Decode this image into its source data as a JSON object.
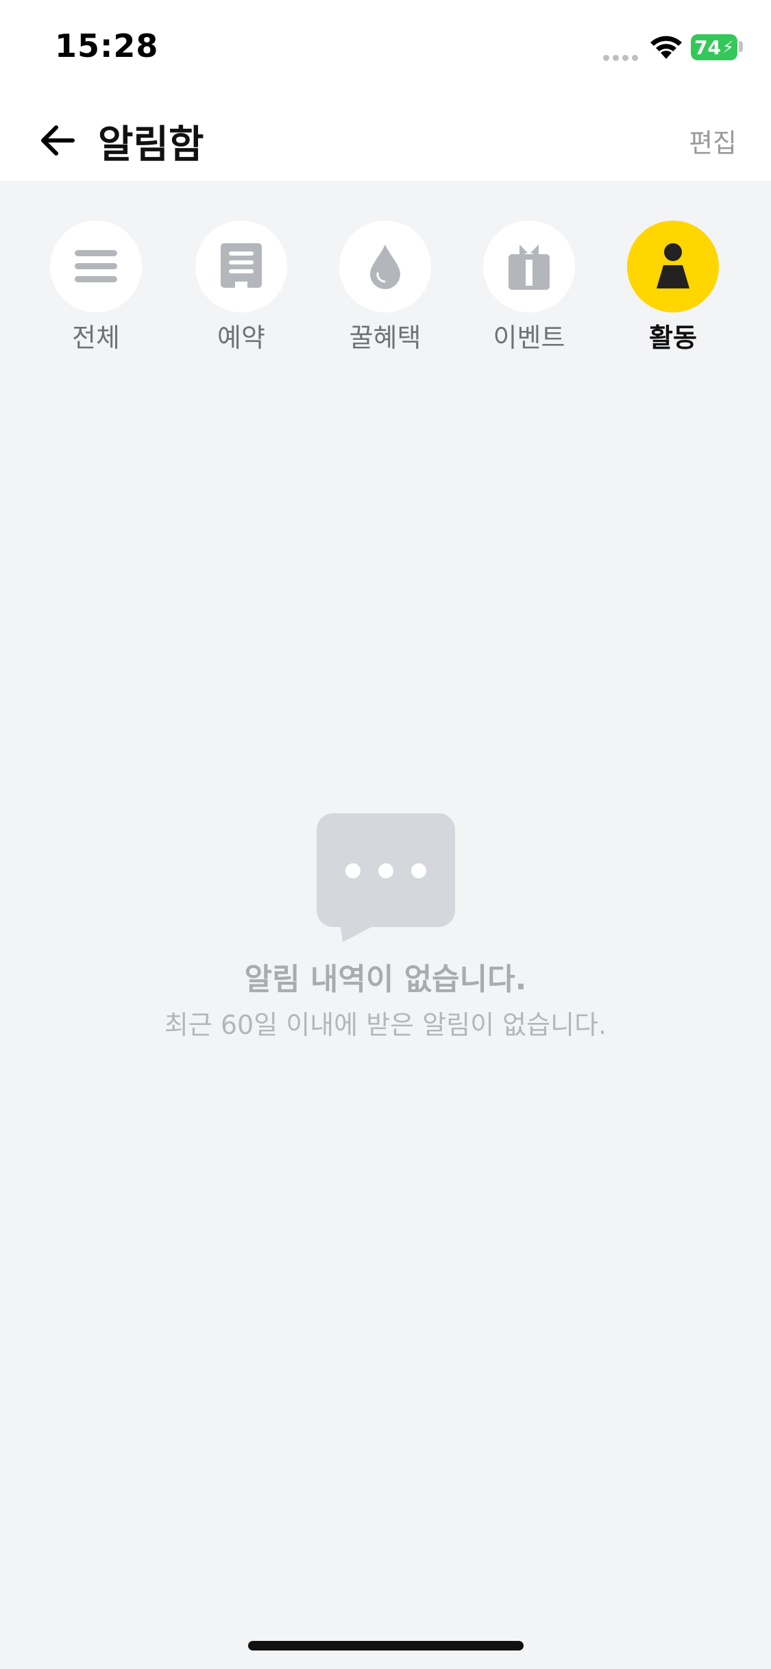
{
  "status_bar": {
    "time": "15:28",
    "battery_level": "74"
  },
  "header": {
    "title": "알림함",
    "edit_label": "편집",
    "back_icon": "arrow-left-icon"
  },
  "tabs": [
    {
      "label": "전체",
      "icon": "menu-lines-icon",
      "active": false
    },
    {
      "label": "예약",
      "icon": "document-icon",
      "active": false
    },
    {
      "label": "꿀혜택",
      "icon": "droplet-icon",
      "active": false
    },
    {
      "label": "이벤트",
      "icon": "gift-icon",
      "active": false
    },
    {
      "label": "활동",
      "icon": "person-icon",
      "active": true
    }
  ],
  "empty_state": {
    "icon": "chat-bubble-icon",
    "title": "알림 내역이 없습니다.",
    "subtitle": "최근 60일 이내에 받은 알림이 없습니다."
  },
  "colors": {
    "accent": "#ffd600",
    "background": "#f3f4f6",
    "icon_gray": "#b3b6bb",
    "battery": "#34c759"
  }
}
